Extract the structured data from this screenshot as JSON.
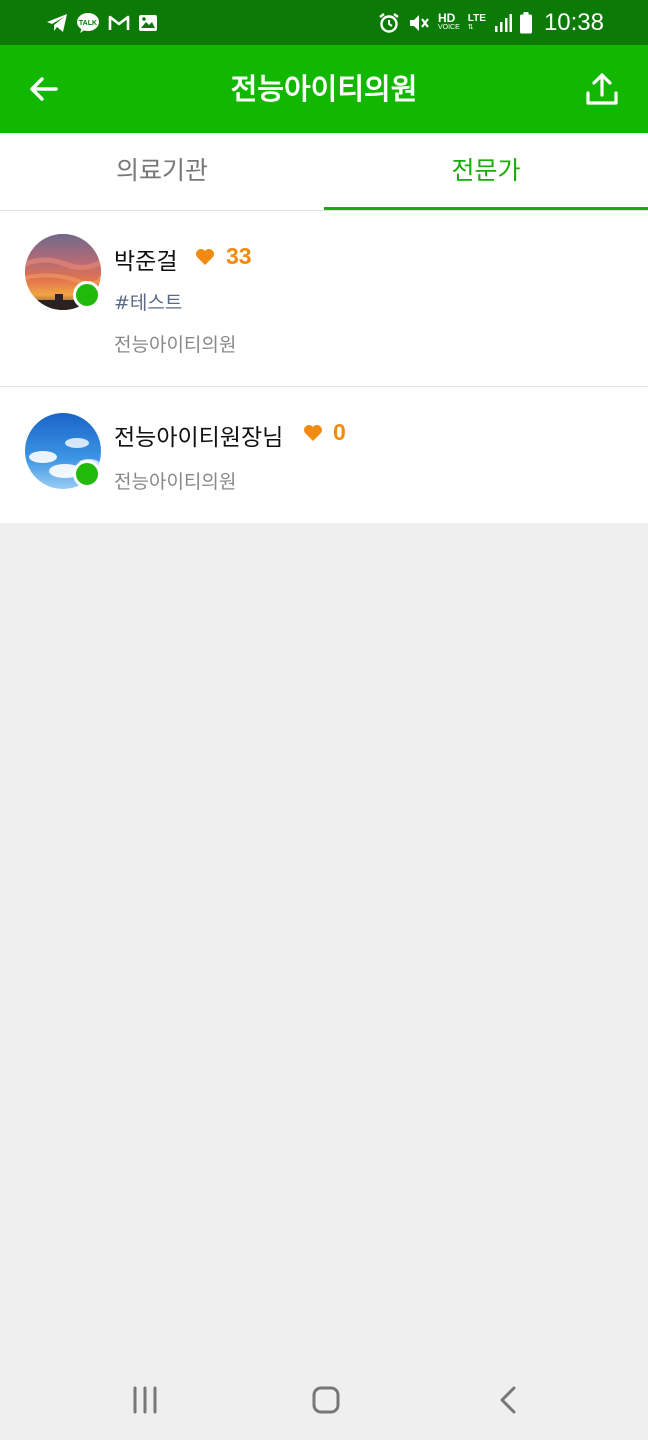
{
  "status_bar": {
    "time": "10:38",
    "left_icons": [
      "telegram-icon",
      "kakaotalk-icon",
      "gmail-icon",
      "gallery-icon"
    ],
    "right_icons": [
      "alarm-icon",
      "mute-icon",
      "hd-voice-icon",
      "lte-icon",
      "signal-icon",
      "battery-icon"
    ],
    "kakao_label": "TALK",
    "hd_label": "HD",
    "voice_label": "VOICE",
    "lte_label": "LTE"
  },
  "app_bar": {
    "title": "전능아이티의원",
    "back_icon": "arrow-left-icon",
    "share_icon": "share-upload-icon"
  },
  "tabs": [
    {
      "label": "의료기관",
      "active": false
    },
    {
      "label": "전문가",
      "active": true
    }
  ],
  "experts": [
    {
      "name": "박준걸",
      "likes": "33",
      "tag": "#테스트",
      "org": "전능아이티의원",
      "online": true
    },
    {
      "name": "전능아이티원장님",
      "likes": "0",
      "org": "전능아이티의원",
      "online": true
    }
  ],
  "colors": {
    "status_bar": "#0c7a06",
    "app_bar": "#12b800",
    "accent": "#1bab0a",
    "likes": "#f28a12",
    "online": "#21b90c"
  },
  "nav_bar": {
    "icons": [
      "recent-apps-icon",
      "home-icon",
      "back-icon"
    ]
  }
}
